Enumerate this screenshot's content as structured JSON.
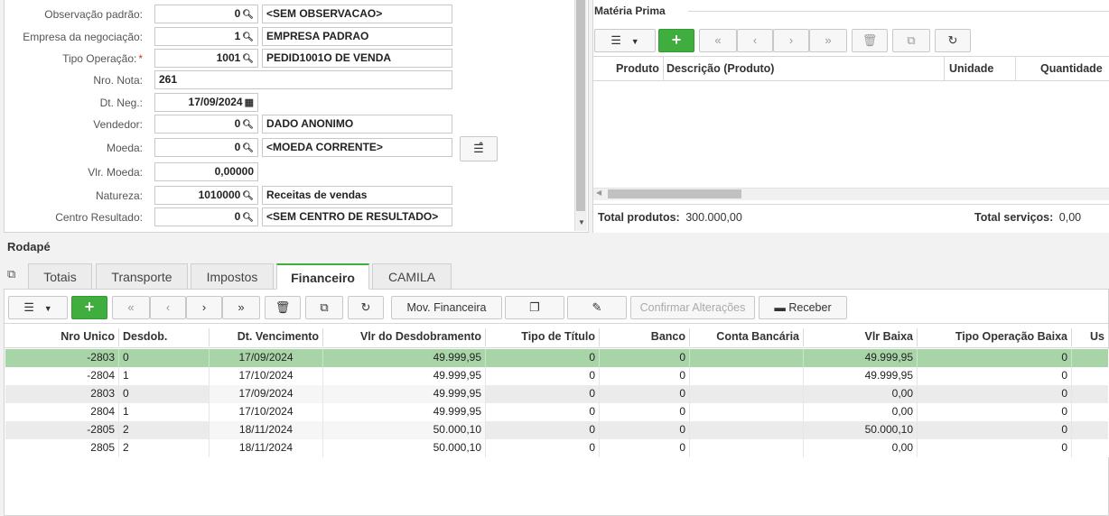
{
  "form": {
    "fields": [
      {
        "label": "Observação padrão:",
        "code": "0",
        "desc": "<SEM OBSERVACAO>"
      },
      {
        "label": "Empresa da negociação:",
        "code": "1",
        "desc": "EMPRESA PADRAO"
      },
      {
        "label": "Tipo Operação:",
        "code": "1001",
        "desc": "PEDID1001O DE VENDA"
      },
      {
        "label": "Nro. Nota:",
        "value": "261"
      },
      {
        "label": "Dt. Neg.:",
        "value": "17/09/2024"
      },
      {
        "label": "Vendedor:",
        "code": "0",
        "desc": "DADO ANONIMO"
      },
      {
        "label": "Moeda:",
        "code": "0",
        "desc": "<MOEDA CORRENTE>"
      },
      {
        "label": "Vlr. Moeda:",
        "value": "0,00000"
      },
      {
        "label": "Natureza:",
        "code": "1010000",
        "desc": "Receitas de vendas"
      },
      {
        "label": "Centro Resultado:",
        "code": "0",
        "desc": "<SEM CENTRO DE RESULTADO>"
      }
    ]
  },
  "materia_prima": {
    "title": "Matéria Prima",
    "columns": [
      "Produto",
      "Descrição (Produto)",
      "Unidade",
      "Quantidade"
    ],
    "total_produtos_label": "Total produtos:",
    "total_produtos_value": "300.000,00",
    "total_servicos_label": "Total serviços:",
    "total_servicos_value": "0,00"
  },
  "rodape": {
    "title": "Rodapé",
    "tabs": [
      "Totais",
      "Transporte",
      "Impostos",
      "Financeiro",
      "CAMILA"
    ],
    "active_tab": "Financeiro",
    "toolbar": {
      "mov_financeira": "Mov. Financeira",
      "confirmar": "Confirmar Alterações",
      "receber": "Receber"
    },
    "columns": [
      "Nro Unico",
      "Desdob.",
      "Dt. Vencimento",
      "Vlr do Desdobramento",
      "Tipo de Título",
      "Banco",
      "Conta Bancária",
      "Vlr Baixa",
      "Tipo Operação Baixa",
      "Us"
    ],
    "rows": [
      {
        "nro": "-2803",
        "desdob": "0",
        "venc": "17/09/2024",
        "vlr": "49.999,95",
        "tipo": "0",
        "banco": "0",
        "conta": "",
        "baixa": "49.999,95",
        "tipo_baixa": "0"
      },
      {
        "nro": "-2804",
        "desdob": "1",
        "venc": "17/10/2024",
        "vlr": "49.999,95",
        "tipo": "0",
        "banco": "0",
        "conta": "",
        "baixa": "49.999,95",
        "tipo_baixa": "0"
      },
      {
        "nro": "2803",
        "desdob": "0",
        "venc": "17/09/2024",
        "vlr": "49.999,95",
        "tipo": "0",
        "banco": "0",
        "conta": "",
        "baixa": "0,00",
        "tipo_baixa": "0"
      },
      {
        "nro": "2804",
        "desdob": "1",
        "venc": "17/10/2024",
        "vlr": "49.999,95",
        "tipo": "0",
        "banco": "0",
        "conta": "",
        "baixa": "0,00",
        "tipo_baixa": "0"
      },
      {
        "nro": "-2805",
        "desdob": "2",
        "venc": "18/11/2024",
        "vlr": "50.000,10",
        "tipo": "0",
        "banco": "0",
        "conta": "",
        "baixa": "50.000,10",
        "tipo_baixa": "0"
      },
      {
        "nro": "2805",
        "desdob": "2",
        "venc": "18/11/2024",
        "vlr": "50.000,10",
        "tipo": "0",
        "banco": "0",
        "conta": "",
        "baixa": "0,00",
        "tipo_baixa": "0"
      }
    ]
  },
  "colors": {
    "accent": "#3fae3f",
    "selected_row": "#a8d5a8",
    "stripe": "#ebebeb"
  }
}
